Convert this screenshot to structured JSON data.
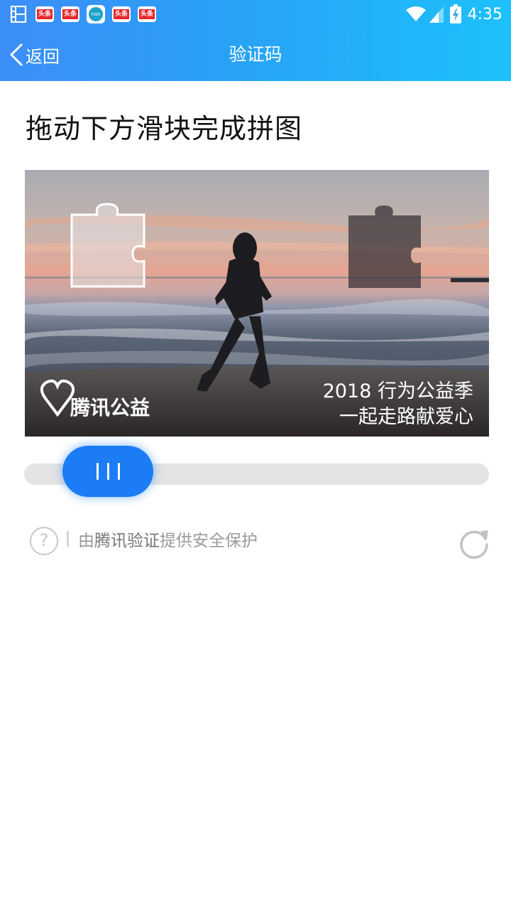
{
  "statusbar": {
    "notification_icons": [
      "film-icon",
      "toutiao-icon",
      "toutiao-icon",
      "nox-icon",
      "toutiao-icon",
      "toutiao-icon"
    ],
    "toutiao_label": "头条",
    "nox_label": "nox",
    "time": "4:35",
    "status_icons": [
      "wifi-icon",
      "signal-icon",
      "battery-charging-icon"
    ]
  },
  "nav": {
    "back_label": "返回",
    "title": "验证码"
  },
  "captcha": {
    "instruction": "拖动下方滑块完成拼图",
    "image": {
      "brand_logo": "腾讯公益",
      "caption_line1": "2018 行为公益季",
      "caption_line2": "一起走路献爱心"
    },
    "slider_progress": 0.08,
    "footer": {
      "provider_prefix": "由",
      "provider_name": "腾讯验证",
      "provider_suffix": "提供安全保护"
    }
  },
  "colors": {
    "header_gradient_start": "#3d8ef7",
    "header_gradient_end": "#1cc1fb",
    "slider_handle": "#1c7cf5",
    "slider_track": "#e4e4e4"
  }
}
